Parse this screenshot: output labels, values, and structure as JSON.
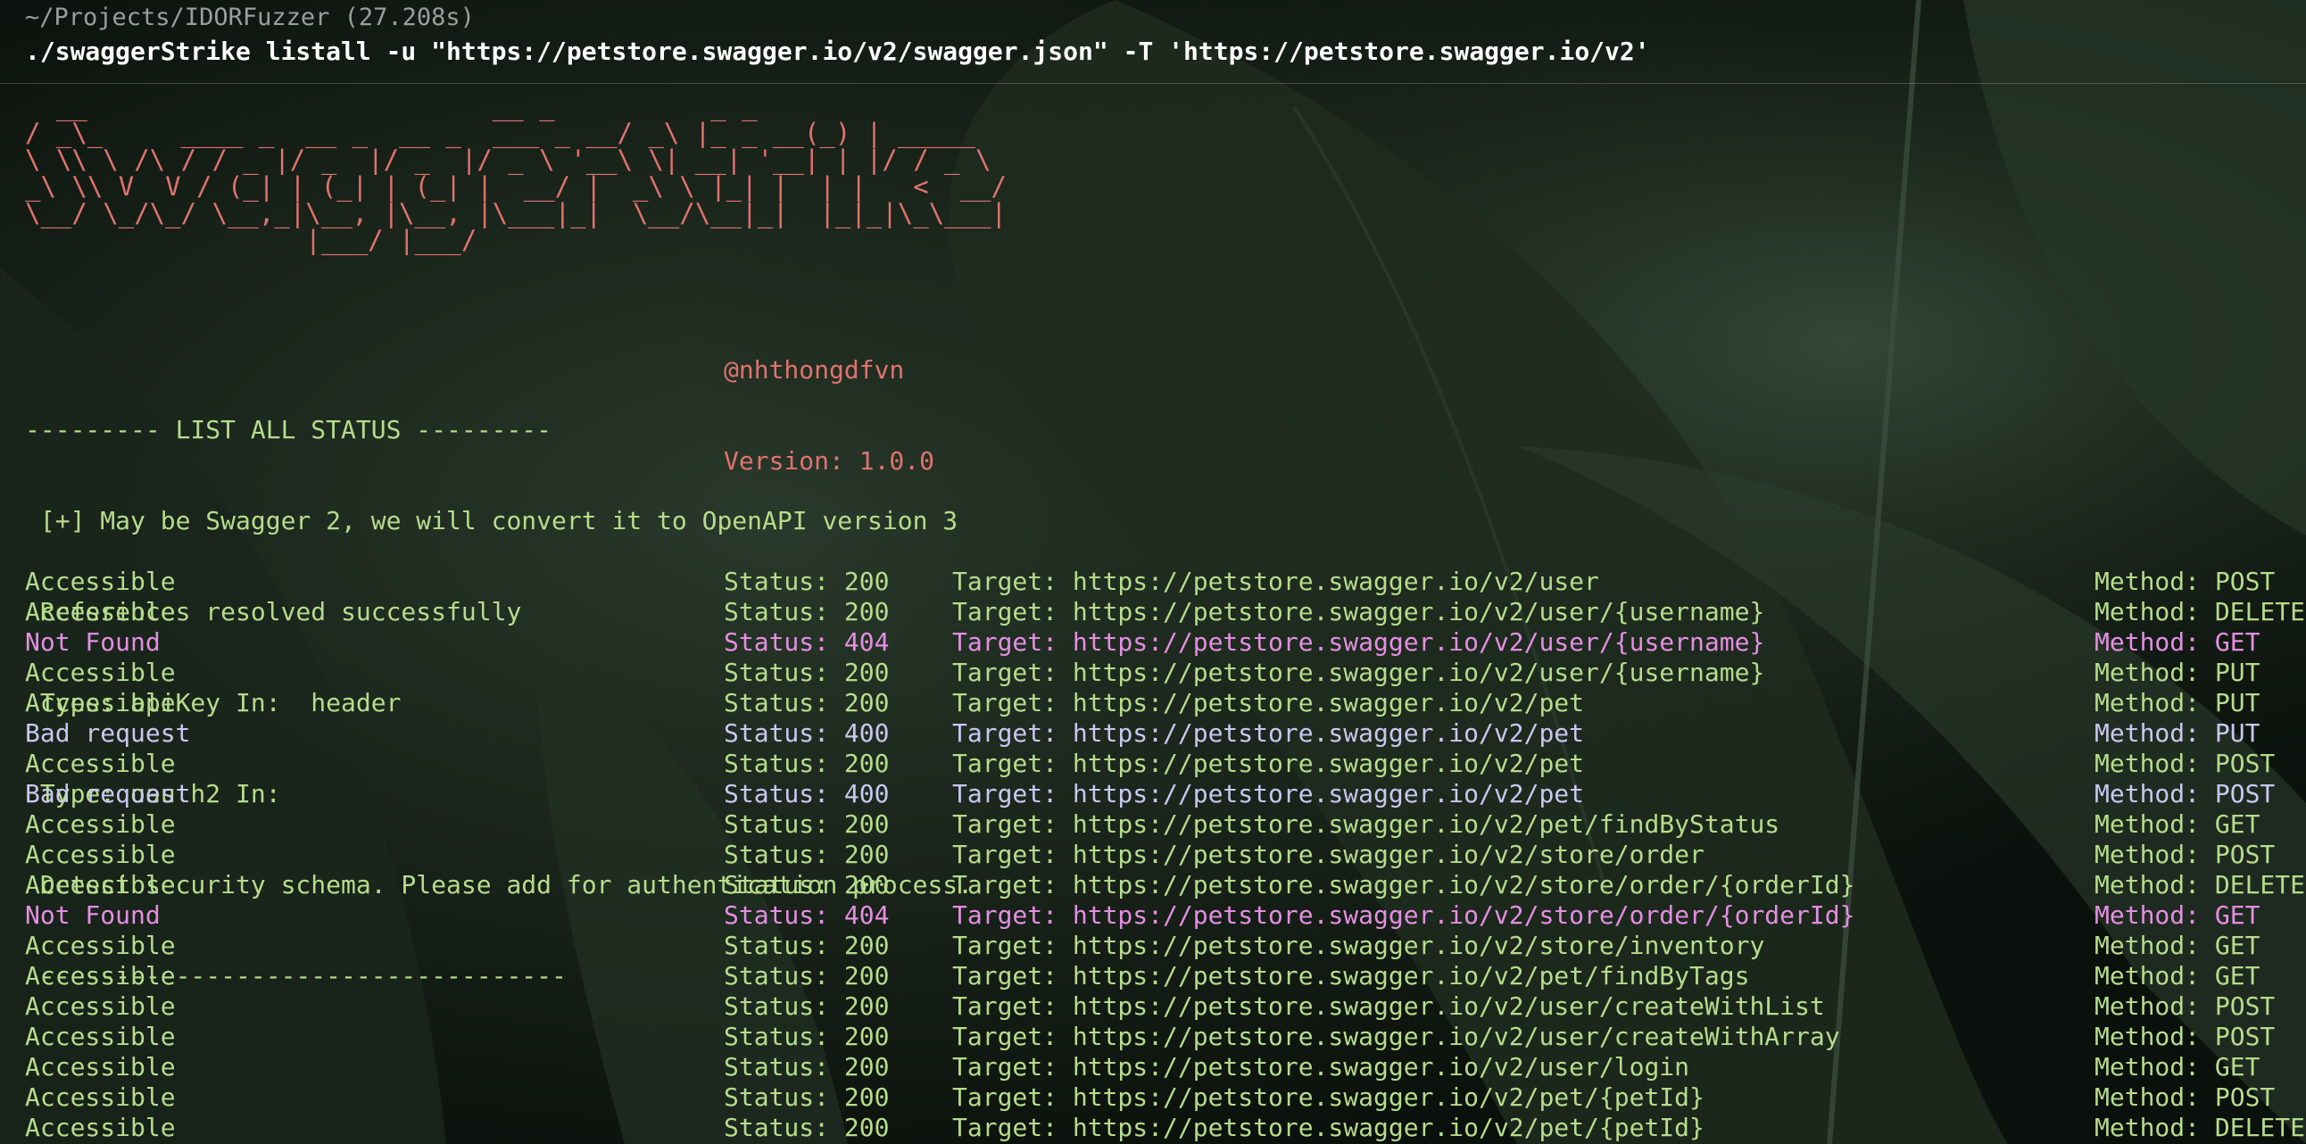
{
  "terminal": {
    "cwd": "~/Projects/IDORFuzzer (27.208s)",
    "command": "./swaggerStrike listall -u \"https://petstore.swagger.io/v2/swagger.json\" -T 'https://petstore.swagger.io/v2'"
  },
  "banner": {
    "ascii_lines": [
      "  __                          __ _          _ _",
      "/ _\\_     ____ _  __ _  __ _  ___ _ __/ _\\ |_ _ __(_) | _____",
      "\\ \\\\ \\ /\\ / / _ |/ _  |/ _  |/ _ \\ '__\\ \\| __| '__| | |/ / _ \\",
      "_\\ \\\\ V  V / (_| | (_| | (_| |  __/ |  _\\ \\ |_| |  | |   <  __/",
      "\\__/ \\_/\\_/ \\__,_|\\__, |\\__, |\\___|_|  \\__/\\__|_|  |_|_|\\_\\___|",
      "                  |___/ |___/"
    ],
    "author": "@nhthongdfvn",
    "version": "Version: 1.0.0"
  },
  "info": {
    "header": "--------- LIST ALL STATUS ---------",
    "messages": [
      " [+] May be Swagger 2, we will convert it to OpenAPI version 3",
      " References resolved successfully",
      " Type: apiKey In:  header",
      " Type: oauth2 In:",
      " Detect security schema. Please add for authentication process."
    ],
    "divider": " -----------------------------------"
  },
  "results": [
    {
      "result": "Accessible",
      "status": "Status: 200",
      "target": "Target: https://petstore.swagger.io/v2/user",
      "method": "Method: POST",
      "kind": "accessible"
    },
    {
      "result": "Accessible",
      "status": "Status: 200",
      "target": "Target: https://petstore.swagger.io/v2/user/{username}",
      "method": "Method: DELETE",
      "kind": "accessible"
    },
    {
      "result": "Not Found",
      "status": "Status: 404",
      "target": "Target: https://petstore.swagger.io/v2/user/{username}",
      "method": "Method: GET",
      "kind": "notfound"
    },
    {
      "result": "Accessible",
      "status": "Status: 200",
      "target": "Target: https://petstore.swagger.io/v2/user/{username}",
      "method": "Method: PUT",
      "kind": "accessible"
    },
    {
      "result": "Accessible",
      "status": "Status: 200",
      "target": "Target: https://petstore.swagger.io/v2/pet",
      "method": "Method: PUT",
      "kind": "accessible"
    },
    {
      "result": "Bad request",
      "status": "Status: 400",
      "target": "Target: https://petstore.swagger.io/v2/pet",
      "method": "Method: PUT",
      "kind": "badrequest"
    },
    {
      "result": "Accessible",
      "status": "Status: 200",
      "target": "Target: https://petstore.swagger.io/v2/pet",
      "method": "Method: POST",
      "kind": "accessible"
    },
    {
      "result": "Bad request",
      "status": "Status: 400",
      "target": "Target: https://petstore.swagger.io/v2/pet",
      "method": "Method: POST",
      "kind": "badrequest"
    },
    {
      "result": "Accessible",
      "status": "Status: 200",
      "target": "Target: https://petstore.swagger.io/v2/pet/findByStatus",
      "method": "Method: GET",
      "kind": "accessible"
    },
    {
      "result": "Accessible",
      "status": "Status: 200",
      "target": "Target: https://petstore.swagger.io/v2/store/order",
      "method": "Method: POST",
      "kind": "accessible"
    },
    {
      "result": "Accessible",
      "status": "Status: 200",
      "target": "Target: https://petstore.swagger.io/v2/store/order/{orderId}",
      "method": "Method: DELETE",
      "kind": "accessible"
    },
    {
      "result": "Not Found",
      "status": "Status: 404",
      "target": "Target: https://petstore.swagger.io/v2/store/order/{orderId}",
      "method": "Method: GET",
      "kind": "notfound"
    },
    {
      "result": "Accessible",
      "status": "Status: 200",
      "target": "Target: https://petstore.swagger.io/v2/store/inventory",
      "method": "Method: GET",
      "kind": "accessible"
    },
    {
      "result": "Accessible",
      "status": "Status: 200",
      "target": "Target: https://petstore.swagger.io/v2/pet/findByTags",
      "method": "Method: GET",
      "kind": "accessible"
    },
    {
      "result": "Accessible",
      "status": "Status: 200",
      "target": "Target: https://petstore.swagger.io/v2/user/createWithList",
      "method": "Method: POST",
      "kind": "accessible"
    },
    {
      "result": "Accessible",
      "status": "Status: 200",
      "target": "Target: https://petstore.swagger.io/v2/user/createWithArray",
      "method": "Method: POST",
      "kind": "accessible"
    },
    {
      "result": "Accessible",
      "status": "Status: 200",
      "target": "Target: https://petstore.swagger.io/v2/user/login",
      "method": "Method: GET",
      "kind": "accessible"
    },
    {
      "result": "Accessible",
      "status": "Status: 200",
      "target": "Target: https://petstore.swagger.io/v2/pet/{petId}",
      "method": "Method: POST",
      "kind": "accessible"
    },
    {
      "result": "Accessible",
      "status": "Status: 200",
      "target": "Target: https://petstore.swagger.io/v2/pet/{petId}",
      "method": "Method: DELETE",
      "kind": "accessible"
    }
  ],
  "colors": {
    "accessible": "#b6dc8c",
    "not_found": "#e58ee3",
    "bad_request": "#c8c8f0",
    "banner": "#e0736e",
    "command": "#ffffff",
    "cwd": "#9a9f9b"
  }
}
